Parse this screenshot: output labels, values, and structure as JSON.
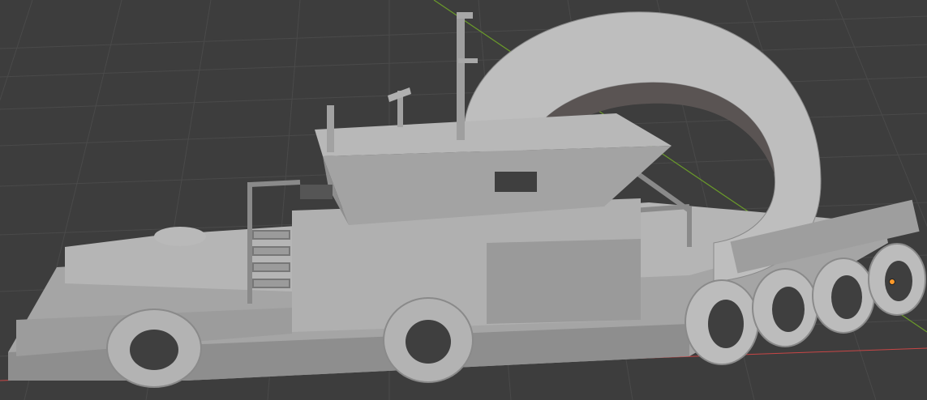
{
  "viewport": {
    "background_color": "#3d3d3d",
    "grid_color": "#4a4a4a",
    "axis_x_color": "#c84646",
    "axis_y_color": "#6a9a2a",
    "origin_color": "#ff9a2a"
  },
  "model": {
    "base_color": "#a9a9a9",
    "light_color": "#bdbdbd",
    "shadow_color": "#8c8c8c",
    "dark_color": "#6e6e6e"
  }
}
